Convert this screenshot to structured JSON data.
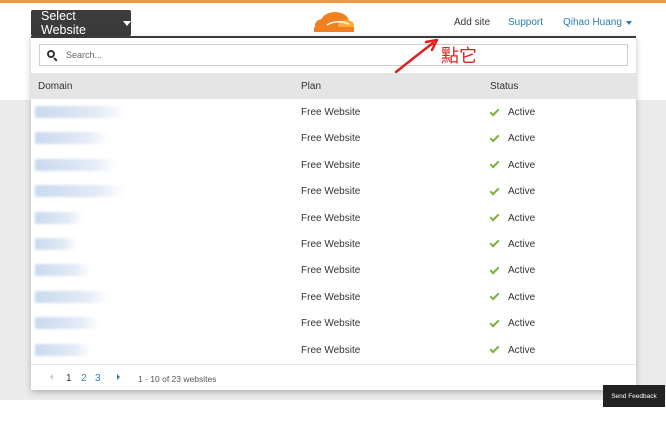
{
  "header": {
    "select_label": "Select Website",
    "nav": {
      "add_site": "Add site",
      "support": "Support",
      "user": "Qihao Huang"
    }
  },
  "search": {
    "placeholder": "Search..."
  },
  "table": {
    "columns": [
      "Domain",
      "Plan",
      "Status"
    ],
    "rows": [
      {
        "plan": "Free Website",
        "status": "Active"
      },
      {
        "plan": "Free Website",
        "status": "Active"
      },
      {
        "plan": "Free Website",
        "status": "Active"
      },
      {
        "plan": "Free Website",
        "status": "Active"
      },
      {
        "plan": "Free Website",
        "status": "Active"
      },
      {
        "plan": "Free Website",
        "status": "Active"
      },
      {
        "plan": "Free Website",
        "status": "Active"
      },
      {
        "plan": "Free Website",
        "status": "Active"
      },
      {
        "plan": "Free Website",
        "status": "Active"
      },
      {
        "plan": "Free Website",
        "status": "Active"
      }
    ]
  },
  "pagination": {
    "pages": [
      "1",
      "2",
      "3"
    ],
    "info": "1 - 10 of 23 websites"
  },
  "feedback_label": "Send Feedback",
  "annotation": {
    "text": "點它"
  },
  "colors": {
    "accent": "#f29644",
    "link": "#2c7cb0",
    "check": "#7bb33a",
    "annotation": "#e0201f"
  }
}
